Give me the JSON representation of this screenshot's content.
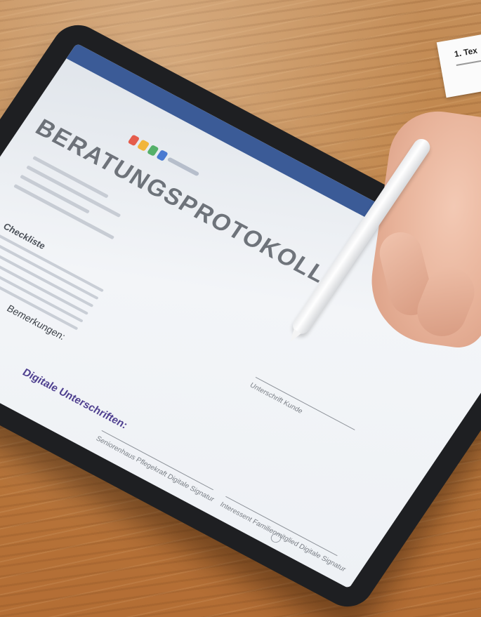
{
  "scene": {
    "description_tags": [
      "tablet",
      "wooden-table",
      "hand",
      "stylus-pen",
      "paper-note"
    ]
  },
  "tablet_screen": {
    "header_title": "BERATUNGSPROTOKOLL",
    "checklist_heading": "Checkliste",
    "remarks_label": "Bemerkungen:",
    "signatures_label": "Digitale Unterschriften:",
    "signature_1": "Seniorenhaus Pflegekraft Digitale Signatur",
    "signature_2": "Interessent Familienmitglied Digitale Signatur",
    "signature_3": "Unterschrift Kunde"
  },
  "paper_note": {
    "title": "1. Tex"
  }
}
